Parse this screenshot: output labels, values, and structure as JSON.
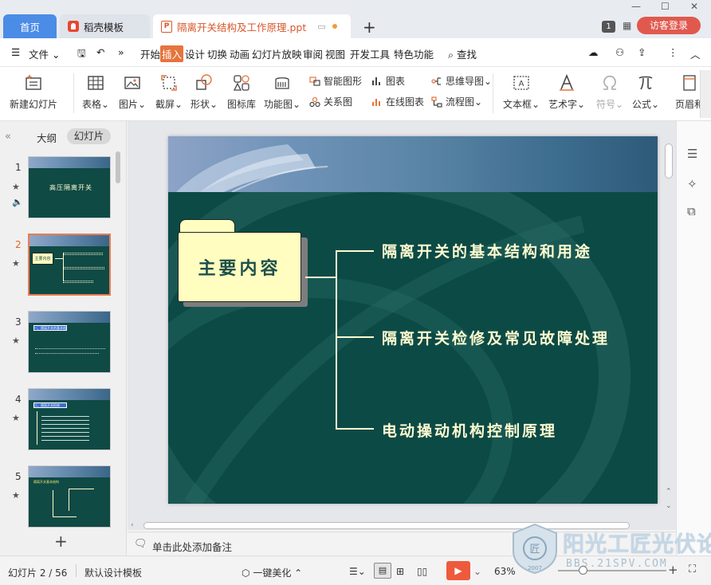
{
  "tabs": {
    "home": "首页",
    "template": "稻壳模板",
    "document": "隔离开关结构及工作原理.ppt"
  },
  "window": {
    "badge": "1",
    "login": "访客登录"
  },
  "menubar": {
    "file": "文件",
    "items": [
      "开始",
      "插入",
      "设计",
      "切换",
      "动画",
      "幻灯片放映",
      "审阅",
      "视图",
      "开发工具",
      "特色功能"
    ],
    "active": "插入",
    "search": "查找"
  },
  "ribbon": {
    "new_slide": "新建幻灯片",
    "table": "表格",
    "picture": "图片",
    "screenshot": "截屏",
    "shape": "形状",
    "icon_lib": "图标库",
    "func_chart": "功能图",
    "smart_shape": "智能图形",
    "chart": "图表",
    "mindmap": "思维导图",
    "relation": "关系图",
    "online_chart": "在线图表",
    "flowchart": "流程图",
    "textbox": "文本框",
    "art_text": "艺术字",
    "symbol": "符号",
    "formula": "公式",
    "header_footer": "页眉和"
  },
  "panel": {
    "outline_tab": "大纲",
    "slides_tab": "幻灯片"
  },
  "thumbnails": [
    {
      "num": "1",
      "title": "高压隔离开关"
    },
    {
      "num": "2",
      "title": "主要内容"
    },
    {
      "num": "3",
      "title": "一、隔离开关的基本结构"
    },
    {
      "num": "4",
      "title": "二、隔离开关检修"
    },
    {
      "num": "5",
      "title": "隔离开关基本结构"
    }
  ],
  "slide": {
    "folder_label": "主要内容",
    "items": [
      "隔离开关的基本结构和用途",
      "隔离开关检修及常见故障处理",
      "电动操动机构控制原理"
    ]
  },
  "notes_placeholder": "单击此处添加备注",
  "status": {
    "slide_counter": "幻灯片 2 / 56",
    "design_template": "默认设计模板",
    "beautify": "一键美化",
    "zoom": "63%"
  },
  "watermark": {
    "text": "阳光工匠光伏论坛",
    "url": "BBS.21SPV.COM",
    "year": "2007"
  },
  "colors": {
    "accent": "#e7743c",
    "slide_bg": "#0c4a46",
    "slide_text": "#fffbd0",
    "home_tab": "#4b8ce6"
  }
}
